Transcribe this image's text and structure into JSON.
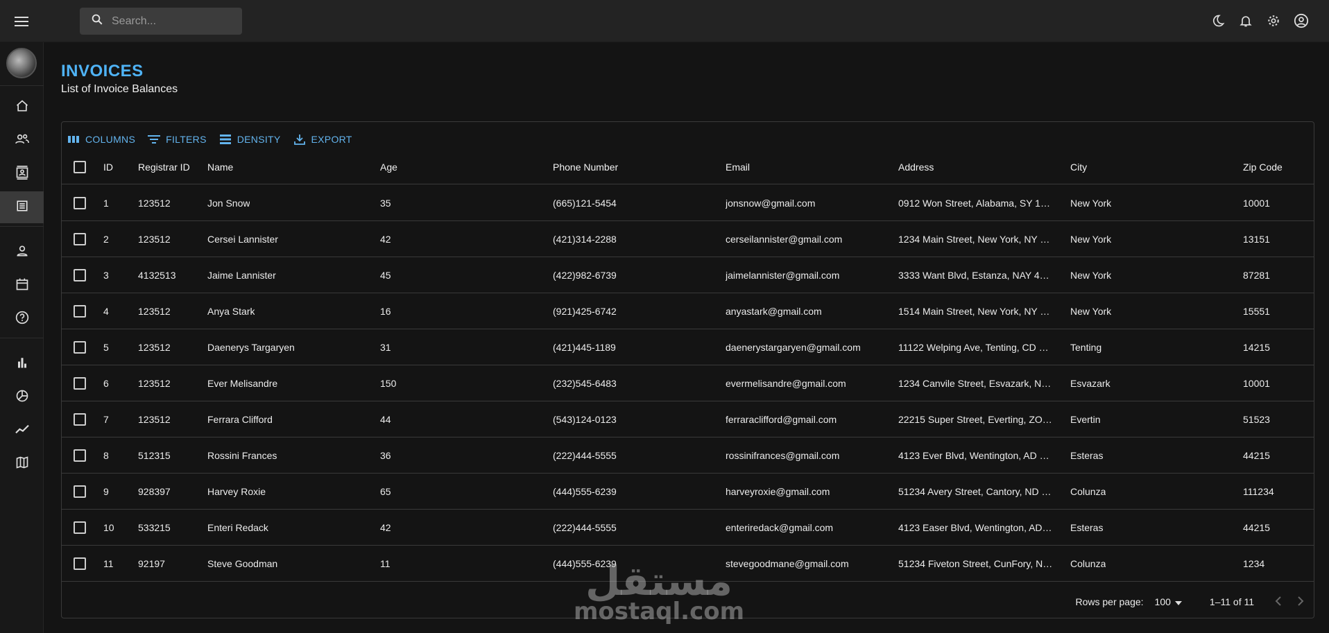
{
  "topbar": {
    "search_placeholder": "Search...",
    "icons": [
      "dark-mode-icon",
      "notifications-icon",
      "settings-icon",
      "account-icon"
    ]
  },
  "sidebar": {
    "items": [
      {
        "name": "home-icon"
      },
      {
        "name": "team-icon"
      },
      {
        "name": "contacts-icon"
      },
      {
        "name": "invoices-icon",
        "active": true
      },
      {
        "name": "profile-icon"
      },
      {
        "name": "calendar-icon"
      },
      {
        "name": "faq-icon"
      },
      {
        "name": "bar-chart-icon"
      },
      {
        "name": "pie-chart-icon"
      },
      {
        "name": "line-chart-icon"
      },
      {
        "name": "geography-icon"
      }
    ]
  },
  "header": {
    "title": "INVOICES",
    "subtitle": "List of Invoice Balances"
  },
  "toolbar": {
    "columns": "COLUMNS",
    "filters": "FILTERS",
    "density": "DENSITY",
    "export": "EXPORT"
  },
  "table": {
    "headers": {
      "id": "ID",
      "registrar": "Registrar ID",
      "name": "Name",
      "age": "Age",
      "phone": "Phone Number",
      "email": "Email",
      "address": "Address",
      "city": "City",
      "zip": "Zip Code"
    },
    "rows": [
      {
        "id": "1",
        "registrar": "123512",
        "name": "Jon Snow",
        "age": "35",
        "phone": "(665)121-5454",
        "email": "jonsnow@gmail.com",
        "address": "0912 Won Street, Alabama, SY 1…",
        "city": "New York",
        "zip": "10001"
      },
      {
        "id": "2",
        "registrar": "123512",
        "name": "Cersei Lannister",
        "age": "42",
        "phone": "(421)314-2288",
        "email": "cerseilannister@gmail.com",
        "address": "1234 Main Street, New York, NY …",
        "city": "New York",
        "zip": "13151"
      },
      {
        "id": "3",
        "registrar": "4132513",
        "name": "Jaime Lannister",
        "age": "45",
        "phone": "(422)982-6739",
        "email": "jaimelannister@gmail.com",
        "address": "3333 Want Blvd, Estanza, NAY 4…",
        "city": "New York",
        "zip": "87281"
      },
      {
        "id": "4",
        "registrar": "123512",
        "name": "Anya Stark",
        "age": "16",
        "phone": "(921)425-6742",
        "email": "anyastark@gmail.com",
        "address": "1514 Main Street, New York, NY …",
        "city": "New York",
        "zip": "15551"
      },
      {
        "id": "5",
        "registrar": "123512",
        "name": "Daenerys Targaryen",
        "age": "31",
        "phone": "(421)445-1189",
        "email": "daenerystargaryen@gmail.com",
        "address": "11122 Welping Ave, Tenting, CD …",
        "city": "Tenting",
        "zip": "14215"
      },
      {
        "id": "6",
        "registrar": "123512",
        "name": "Ever Melisandre",
        "age": "150",
        "phone": "(232)545-6483",
        "email": "evermelisandre@gmail.com",
        "address": "1234 Canvile Street, Esvazark, N…",
        "city": "Esvazark",
        "zip": "10001"
      },
      {
        "id": "7",
        "registrar": "123512",
        "name": "Ferrara Clifford",
        "age": "44",
        "phone": "(543)124-0123",
        "email": "ferraraclifford@gmail.com",
        "address": "22215 Super Street, Everting, ZO…",
        "city": "Evertin",
        "zip": "51523"
      },
      {
        "id": "8",
        "registrar": "512315",
        "name": "Rossini Frances",
        "age": "36",
        "phone": "(222)444-5555",
        "email": "rossinifrances@gmail.com",
        "address": "4123 Ever Blvd, Wentington, AD …",
        "city": "Esteras",
        "zip": "44215"
      },
      {
        "id": "9",
        "registrar": "928397",
        "name": "Harvey Roxie",
        "age": "65",
        "phone": "(444)555-6239",
        "email": "harveyroxie@gmail.com",
        "address": "51234 Avery Street, Cantory, ND …",
        "city": "Colunza",
        "zip": "111234"
      },
      {
        "id": "10",
        "registrar": "533215",
        "name": "Enteri Redack",
        "age": "42",
        "phone": "(222)444-5555",
        "email": "enteriredack@gmail.com",
        "address": "4123 Easer Blvd, Wentington, AD…",
        "city": "Esteras",
        "zip": "44215"
      },
      {
        "id": "11",
        "registrar": "92197",
        "name": "Steve Goodman",
        "age": "11",
        "phone": "(444)555-6239",
        "email": "stevegoodmane@gmail.com",
        "address": "51234 Fiveton Street, CunFory, N…",
        "city": "Colunza",
        "zip": "1234"
      }
    ]
  },
  "footer": {
    "rows_per_page_label": "Rows per page:",
    "rows_per_page_value": "100",
    "range": "1–11 of 11"
  },
  "watermark": {
    "arabic": "مستقل",
    "latin": "mostaql.com"
  },
  "colors": {
    "accent": "#4fb3f6",
    "background": "#141414",
    "topbar": "#232323"
  }
}
